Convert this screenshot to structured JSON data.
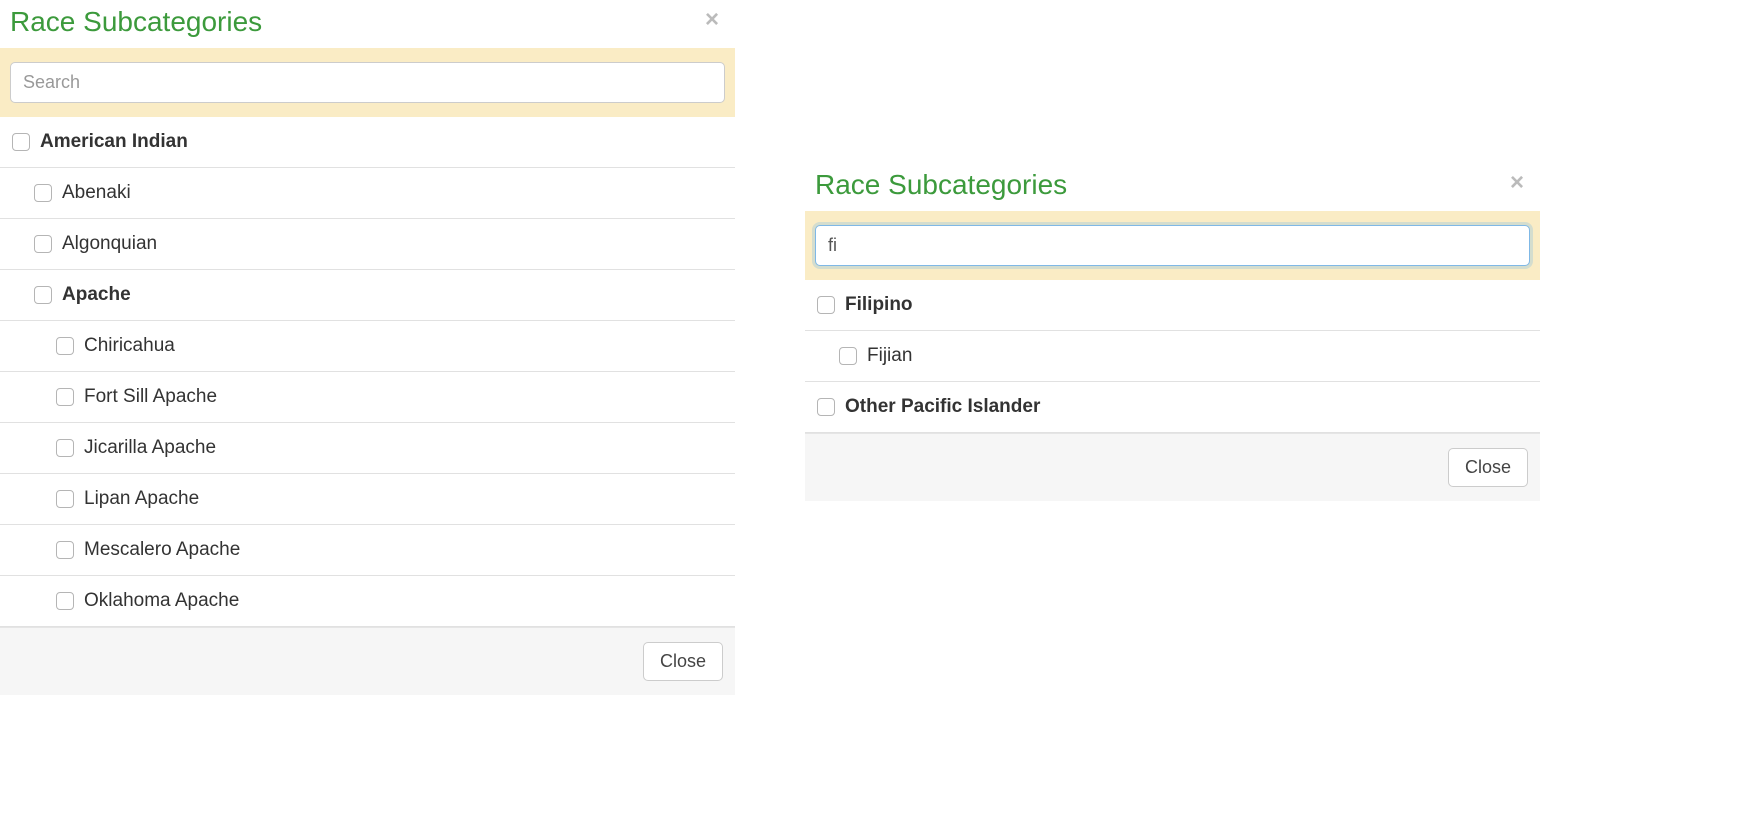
{
  "modalLeft": {
    "title": "Race Subcategories",
    "searchPlaceholder": "Search",
    "searchValue": "",
    "closeButton": "Close",
    "items": [
      {
        "label": "American Indian",
        "level": 0,
        "bold": true
      },
      {
        "label": "Abenaki",
        "level": 1,
        "bold": false
      },
      {
        "label": "Algonquian",
        "level": 1,
        "bold": false
      },
      {
        "label": "Apache",
        "level": 1,
        "bold": true
      },
      {
        "label": "Chiricahua",
        "level": 2,
        "bold": false
      },
      {
        "label": "Fort Sill Apache",
        "level": 2,
        "bold": false
      },
      {
        "label": "Jicarilla Apache",
        "level": 2,
        "bold": false
      },
      {
        "label": "Lipan Apache",
        "level": 2,
        "bold": false
      },
      {
        "label": "Mescalero Apache",
        "level": 2,
        "bold": false
      },
      {
        "label": "Oklahoma Apache",
        "level": 2,
        "bold": false
      }
    ]
  },
  "modalRight": {
    "title": "Race Subcategories",
    "searchPlaceholder": "Search",
    "searchValue": "fi",
    "closeButton": "Close",
    "items": [
      {
        "label": "Filipino",
        "level": 0,
        "bold": true
      },
      {
        "label": "Fijian",
        "level": 1,
        "bold": false
      },
      {
        "label": "Other Pacific Islander",
        "level": 0,
        "bold": true
      }
    ]
  }
}
